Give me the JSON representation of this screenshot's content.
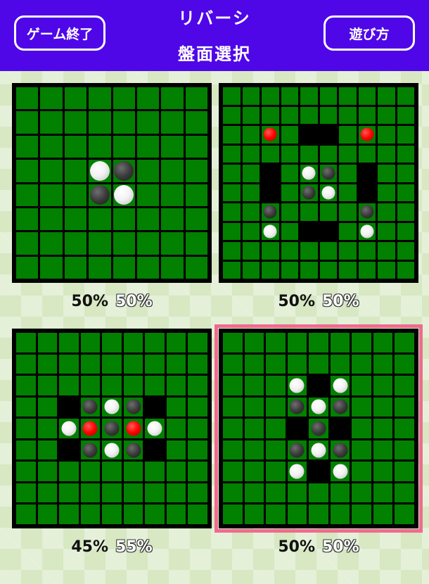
{
  "header": {
    "title": "リバーシ",
    "subtitle": "盤面選択",
    "left_button": "ゲーム終了",
    "right_button": "遊び方"
  },
  "colors": {
    "header": "#4f07e8",
    "board_green": "#028000",
    "selected_frame": "#ef6b8e"
  },
  "boards": [
    {
      "name": "standard-8x8",
      "size": 8,
      "black_pct": "50%",
      "white_pct": "50%",
      "selected": false,
      "blocked": [],
      "discs": [
        {
          "r": 3,
          "c": 3,
          "color": "white"
        },
        {
          "r": 3,
          "c": 4,
          "color": "black"
        },
        {
          "r": 4,
          "c": 3,
          "color": "black"
        },
        {
          "r": 4,
          "c": 4,
          "color": "white"
        }
      ]
    },
    {
      "name": "blocked-10x10",
      "size": 10,
      "black_pct": "50%",
      "white_pct": "50%",
      "selected": false,
      "blocked": [
        [
          2,
          4
        ],
        [
          2,
          5
        ],
        [
          4,
          2
        ],
        [
          5,
          2
        ],
        [
          4,
          7
        ],
        [
          5,
          7
        ],
        [
          7,
          4
        ],
        [
          7,
          5
        ]
      ],
      "discs": [
        {
          "r": 2,
          "c": 2,
          "color": "red"
        },
        {
          "r": 2,
          "c": 7,
          "color": "red"
        },
        {
          "r": 4,
          "c": 4,
          "color": "white"
        },
        {
          "r": 4,
          "c": 5,
          "color": "black"
        },
        {
          "r": 5,
          "c": 4,
          "color": "black"
        },
        {
          "r": 5,
          "c": 5,
          "color": "white"
        },
        {
          "r": 6,
          "c": 2,
          "color": "black"
        },
        {
          "r": 6,
          "c": 7,
          "color": "black"
        },
        {
          "r": 7,
          "c": 2,
          "color": "white"
        },
        {
          "r": 7,
          "c": 7,
          "color": "white"
        }
      ]
    },
    {
      "name": "cross-9x9",
      "size": 9,
      "black_pct": "45%",
      "white_pct": "55%",
      "selected": false,
      "blocked": [
        [
          3,
          2
        ],
        [
          3,
          6
        ],
        [
          5,
          2
        ],
        [
          5,
          6
        ]
      ],
      "discs": [
        {
          "r": 3,
          "c": 3,
          "color": "black"
        },
        {
          "r": 3,
          "c": 4,
          "color": "white"
        },
        {
          "r": 3,
          "c": 5,
          "color": "black"
        },
        {
          "r": 4,
          "c": 2,
          "color": "white"
        },
        {
          "r": 4,
          "c": 3,
          "color": "red"
        },
        {
          "r": 4,
          "c": 4,
          "color": "black"
        },
        {
          "r": 4,
          "c": 5,
          "color": "red"
        },
        {
          "r": 4,
          "c": 6,
          "color": "white"
        },
        {
          "r": 5,
          "c": 3,
          "color": "black"
        },
        {
          "r": 5,
          "c": 4,
          "color": "white"
        },
        {
          "r": 5,
          "c": 5,
          "color": "black"
        }
      ]
    },
    {
      "name": "diamond-9x9",
      "size": 9,
      "black_pct": "50%",
      "white_pct": "50%",
      "selected": true,
      "blocked": [
        [
          2,
          4
        ],
        [
          4,
          3
        ],
        [
          4,
          5
        ],
        [
          6,
          4
        ]
      ],
      "discs": [
        {
          "r": 2,
          "c": 3,
          "color": "white"
        },
        {
          "r": 2,
          "c": 5,
          "color": "white"
        },
        {
          "r": 3,
          "c": 3,
          "color": "black"
        },
        {
          "r": 3,
          "c": 4,
          "color": "white"
        },
        {
          "r": 3,
          "c": 5,
          "color": "black"
        },
        {
          "r": 4,
          "c": 4,
          "color": "black"
        },
        {
          "r": 5,
          "c": 3,
          "color": "black"
        },
        {
          "r": 5,
          "c": 4,
          "color": "white"
        },
        {
          "r": 5,
          "c": 5,
          "color": "black"
        },
        {
          "r": 6,
          "c": 3,
          "color": "white"
        },
        {
          "r": 6,
          "c": 5,
          "color": "white"
        }
      ]
    }
  ]
}
